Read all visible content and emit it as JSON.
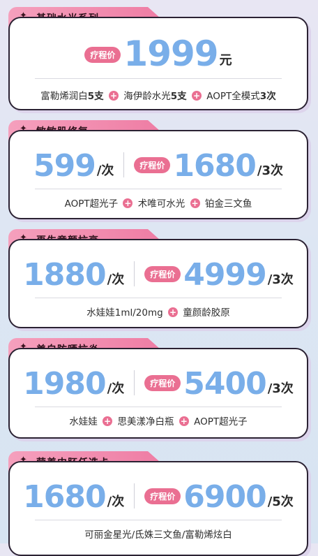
{
  "cards": [
    {
      "title": "基础水光系列",
      "pill": "疗程价",
      "price": "1999",
      "unit": "元",
      "items": [
        {
          "text": "富勒烯润白",
          "count": "5支"
        },
        {
          "text": "海伊龄水光",
          "count": "5支"
        },
        {
          "text": "AOPT全模式",
          "count": "3次"
        }
      ]
    },
    {
      "title": "敏敏肌修复",
      "single_price": "599",
      "single_unit": "/次",
      "pill": "疗程价",
      "course_price": "1680",
      "course_unit": "/3次",
      "items": [
        "AOPT超光子",
        "术唯可水光",
        "铂金三文鱼"
      ]
    },
    {
      "title": "再生童颜抗衰",
      "single_price": "1880",
      "single_unit": "/次",
      "pill": "疗程价",
      "course_price": "4999",
      "course_unit": "/3次",
      "items": [
        "水娃娃1ml/20mg",
        "童颜龄胶原"
      ]
    },
    {
      "title": "美白防晒抗炎",
      "single_price": "1980",
      "single_unit": "/次",
      "pill": "疗程价",
      "course_price": "5400",
      "course_unit": "/3次",
      "items": [
        "水娃娃",
        "思美漾净白瓶",
        "AOPT超光子"
      ]
    },
    {
      "title": "营养中胚任选卡",
      "single_price": "1680",
      "single_unit": "/次",
      "pill": "疗程价",
      "course_price": "6900",
      "course_unit": "/5次",
      "items": [
        "可丽金星光/氐姝三文鱼/富勒烯炫白"
      ]
    }
  ],
  "tag_symbol": "✦",
  "plus_symbol": "+"
}
